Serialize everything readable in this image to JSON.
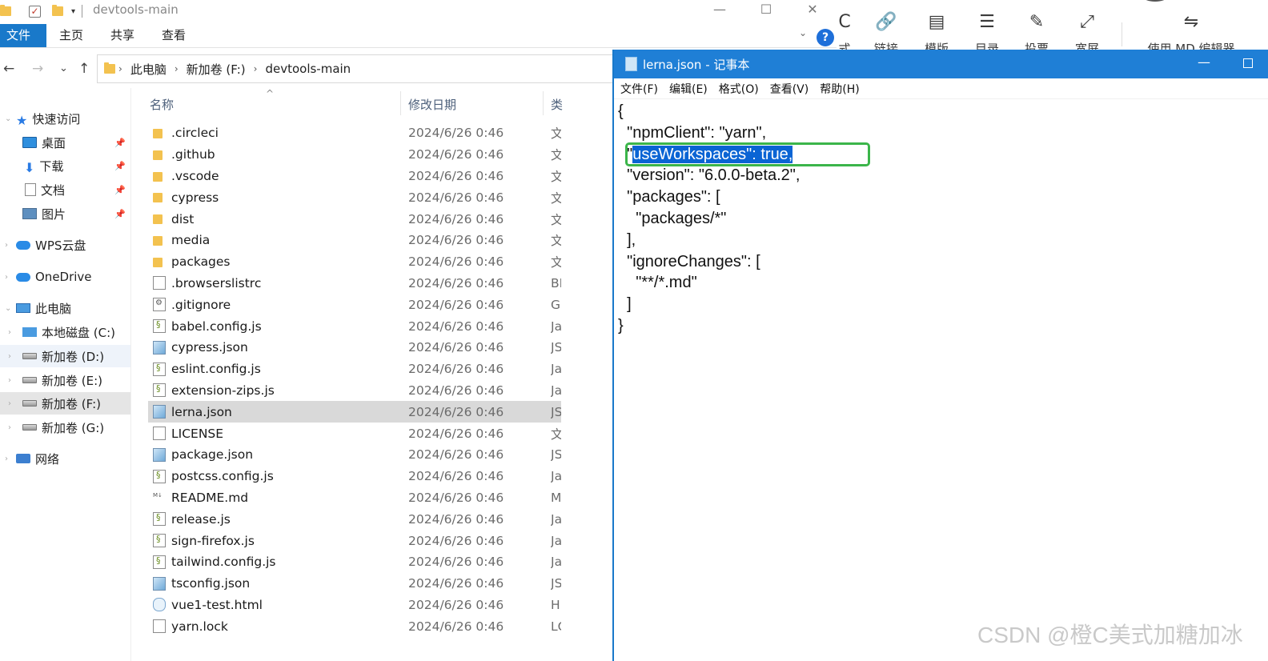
{
  "explorer": {
    "window_title": "devtools-main",
    "controls": {
      "minimize": "—",
      "maximize": "☐",
      "close": "✕"
    },
    "ribbon_tabs": [
      "文件",
      "主页",
      "共享",
      "查看"
    ],
    "help": "?",
    "nav": {
      "back": "←",
      "forward": "→",
      "recent": "⌄",
      "up": "↑"
    },
    "breadcrumb": [
      "此电脑",
      "新加卷 (F:)",
      "devtools-main"
    ],
    "sidebar": {
      "quick_access": "快速访问",
      "quick_items": [
        "桌面",
        "下载",
        "文档",
        "图片"
      ],
      "wps": "WPS云盘",
      "onedrive": "OneDrive",
      "this_pc": "此电脑",
      "drives": [
        "本地磁盘 (C:)",
        "新加卷 (D:)",
        "新加卷 (E:)",
        "新加卷 (F:)",
        "新加卷 (G:)"
      ],
      "network": "网络"
    },
    "columns": {
      "name": "名称",
      "modified": "修改日期",
      "type": "类"
    },
    "files": [
      {
        "name": ".circleci",
        "date": "2024/6/26 0:46",
        "type": "文",
        "icon": "folder"
      },
      {
        "name": ".github",
        "date": "2024/6/26 0:46",
        "type": "文",
        "icon": "folder"
      },
      {
        "name": ".vscode",
        "date": "2024/6/26 0:46",
        "type": "文",
        "icon": "folder"
      },
      {
        "name": "cypress",
        "date": "2024/6/26 0:46",
        "type": "文",
        "icon": "folder"
      },
      {
        "name": "dist",
        "date": "2024/6/26 0:46",
        "type": "文",
        "icon": "folder"
      },
      {
        "name": "media",
        "date": "2024/6/26 0:46",
        "type": "文",
        "icon": "folder"
      },
      {
        "name": "packages",
        "date": "2024/6/26 0:46",
        "type": "文",
        "icon": "folder"
      },
      {
        "name": ".browserslistrc",
        "date": "2024/6/26 0:46",
        "type": "BI",
        "icon": "file"
      },
      {
        "name": ".gitignore",
        "date": "2024/6/26 0:46",
        "type": "G",
        "icon": "cfg"
      },
      {
        "name": "babel.config.js",
        "date": "2024/6/26 0:46",
        "type": "Ja",
        "icon": "js"
      },
      {
        "name": "cypress.json",
        "date": "2024/6/26 0:46",
        "type": "JS",
        "icon": "json"
      },
      {
        "name": "eslint.config.js",
        "date": "2024/6/26 0:46",
        "type": "Ja",
        "icon": "js"
      },
      {
        "name": "extension-zips.js",
        "date": "2024/6/26 0:46",
        "type": "Ja",
        "icon": "js"
      },
      {
        "name": "lerna.json",
        "date": "2024/6/26 0:46",
        "type": "JS",
        "icon": "json"
      },
      {
        "name": "LICENSE",
        "date": "2024/6/26 0:46",
        "type": "文",
        "icon": "file"
      },
      {
        "name": "package.json",
        "date": "2024/6/26 0:46",
        "type": "JS",
        "icon": "json"
      },
      {
        "name": "postcss.config.js",
        "date": "2024/6/26 0:46",
        "type": "Ja",
        "icon": "js"
      },
      {
        "name": "README.md",
        "date": "2024/6/26 0:46",
        "type": "M",
        "icon": "md"
      },
      {
        "name": "release.js",
        "date": "2024/6/26 0:46",
        "type": "Ja",
        "icon": "js"
      },
      {
        "name": "sign-firefox.js",
        "date": "2024/6/26 0:46",
        "type": "Ja",
        "icon": "js"
      },
      {
        "name": "tailwind.config.js",
        "date": "2024/6/26 0:46",
        "type": "Ja",
        "icon": "js"
      },
      {
        "name": "tsconfig.json",
        "date": "2024/6/26 0:46",
        "type": "JS",
        "icon": "json"
      },
      {
        "name": "vue1-test.html",
        "date": "2024/6/26 0:46",
        "type": "H",
        "icon": "html"
      },
      {
        "name": "yarn.lock",
        "date": "2024/6/26 0:46",
        "type": "LC",
        "icon": "file"
      }
    ],
    "selected_file": "lerna.json"
  },
  "toolbar": {
    "items": [
      {
        "icon": "format-icon",
        "glyph": "C",
        "label": "式"
      },
      {
        "icon": "link-icon",
        "glyph": "🔗",
        "label": "链接"
      },
      {
        "icon": "template-icon",
        "glyph": "▤",
        "label": "模版"
      },
      {
        "icon": "toc-icon",
        "glyph": "☰",
        "label": "目录"
      },
      {
        "icon": "vote-icon",
        "glyph": "✎",
        "label": "投票"
      },
      {
        "icon": "fullscreen-icon",
        "glyph": "⤢",
        "label": "宽屏"
      },
      {
        "icon": "switch-icon",
        "glyph": "⇋",
        "label": "使用 MD 编辑器"
      }
    ]
  },
  "notepad": {
    "title": "lerna.json - 记事本",
    "menu": [
      "文件(F)",
      "编辑(E)",
      "格式(O)",
      "查看(V)",
      "帮助(H)"
    ],
    "lines": [
      "{",
      "  \"npmClient\": \"yarn\",",
      "  \"",
      "  \"version\": \"6.0.0-beta.2\",",
      "  \"packages\": [",
      "    \"packages/*\"",
      "  ],",
      "  \"ignoreChanges\": [",
      "    \"**/*.md\"",
      "  ]",
      "}"
    ],
    "selected_text": "useWorkspaces\": true,",
    "highlight_color": "#3bb54a",
    "selection_color": "#0a64d4"
  },
  "watermark": "CSDN @橙C美式加糖加冰"
}
